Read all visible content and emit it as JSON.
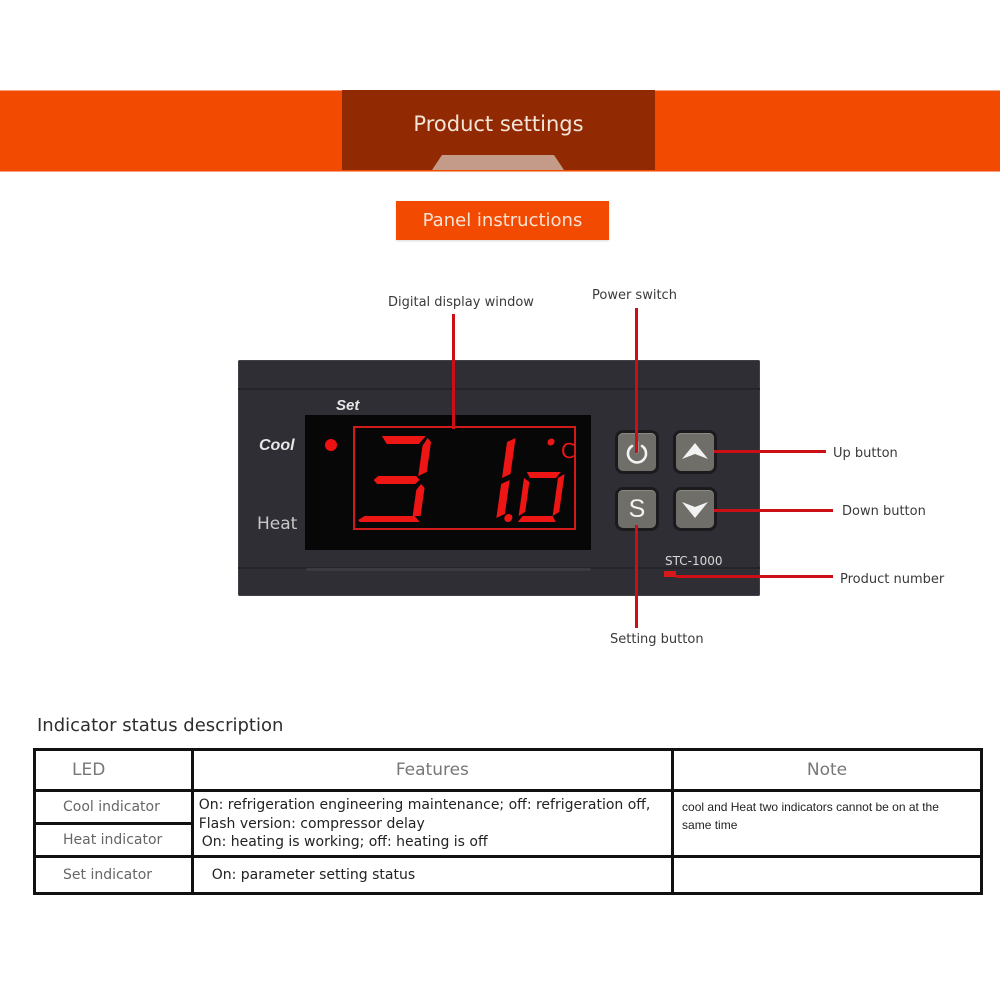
{
  "banner": {
    "title": "Product settings"
  },
  "panel_button": {
    "label": "Panel instructions"
  },
  "device": {
    "labels": {
      "set": "Set",
      "cool": "Cool",
      "heat": "Heat"
    },
    "display": {
      "reading": "31.0",
      "unit": "°C",
      "cool_led_on": true
    },
    "model": "STC-1000",
    "buttons": {
      "power": "power-icon",
      "up": "chevron-up-icon",
      "setting": "S",
      "down": "chevron-down-icon"
    }
  },
  "callouts": {
    "display_window": "Digital display window",
    "power_switch": "Power switch",
    "up_button": "Up button",
    "down_button": "Down button",
    "product_number": "Product number",
    "setting_button": "Setting button"
  },
  "indicator_table": {
    "title": "Indicator status description",
    "headers": [
      "LED",
      "Features",
      "Note"
    ],
    "rows": [
      {
        "led": "Cool indicator",
        "features": "On: refrigeration engineering maintenance; off: refrigeration off,",
        "features_2": "Flash version: compressor delay"
      },
      {
        "led": "Heat indicator",
        "features": "On: heating is working; off: heating is off"
      },
      {
        "led": "Set indicator",
        "features": "On: parameter setting status",
        "note": ""
      }
    ],
    "note_merged": "cool and Heat two indicators cannot be on at the same time"
  },
  "colors": {
    "accent": "#f24a00",
    "accent_dark": "#912a02",
    "led_red": "#ee1111",
    "callout_red": "#cc0f17"
  }
}
